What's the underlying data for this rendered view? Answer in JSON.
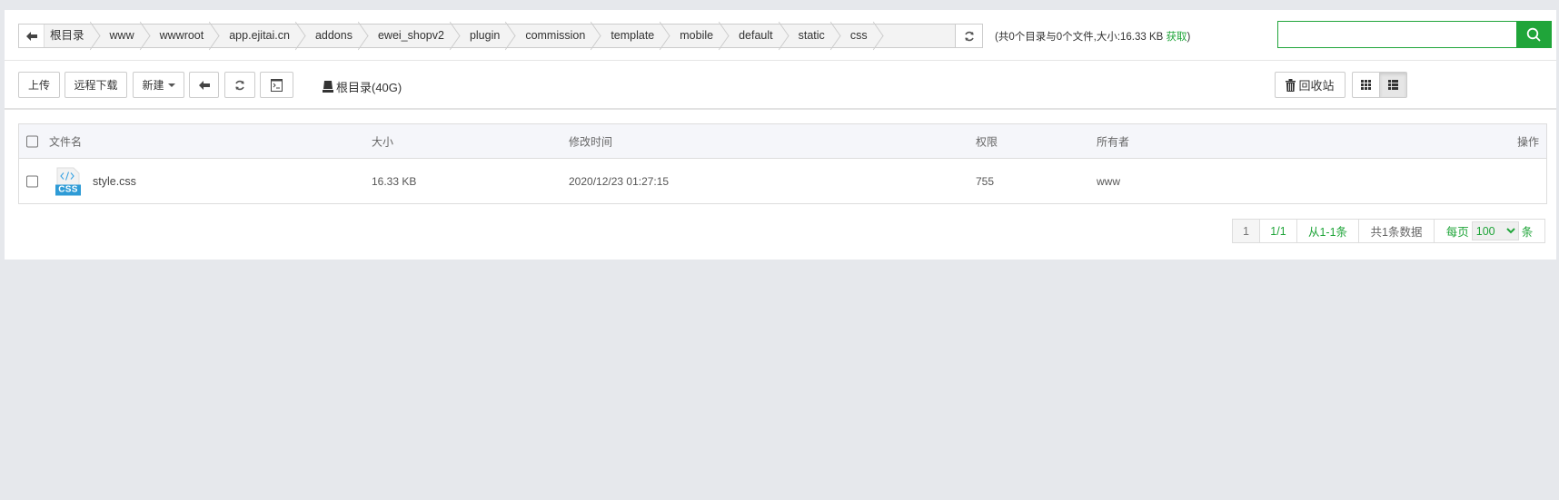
{
  "breadcrumb": {
    "items": [
      "根目录",
      "www",
      "wwwroot",
      "app.ejitai.cn",
      "addons",
      "ewei_shopv2",
      "plugin",
      "commission",
      "template",
      "mobile",
      "default",
      "static",
      "css"
    ]
  },
  "dir_info": {
    "text": "(共0个目录与0个文件,大小:16.33 KB ",
    "link": "获取",
    "close": ")"
  },
  "search": {
    "value": "",
    "placeholder": ""
  },
  "toolbar": {
    "upload": "上传",
    "remote_download": "远程下载",
    "new": "新建",
    "disk": "根目录(40G)",
    "recycle": "回收站"
  },
  "table": {
    "headers": {
      "name": "文件名",
      "size": "大小",
      "mtime": "修改时间",
      "perm": "权限",
      "owner": "所有者",
      "ops": "操作"
    },
    "rows": [
      {
        "name": "style.css",
        "icon": "css-file-icon",
        "icon_label": "CSS",
        "size": "16.33 KB",
        "mtime": "2020/12/23 01:27:15",
        "perm": "755",
        "owner": "www"
      }
    ]
  },
  "pager": {
    "current": "1",
    "pages": "1/1",
    "range": "从1-1条",
    "total": "共1条数据",
    "per_page_label": "每页",
    "per_page": "100",
    "unit": "条"
  },
  "colors": {
    "accent": "#20a53a",
    "header_bg": "#f5f6fa",
    "background": "#e6e8ec"
  }
}
